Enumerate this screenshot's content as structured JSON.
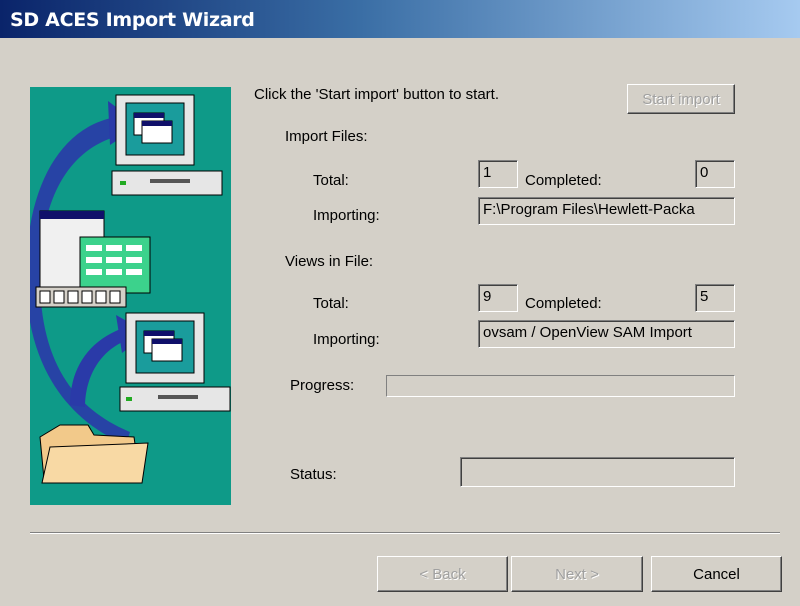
{
  "window": {
    "title": "SD ACES Import Wizard"
  },
  "intro": {
    "text": "Click the 'Start import' button to start."
  },
  "buttons": {
    "start_import": "Start import",
    "back": "< Back",
    "next": "Next >",
    "cancel": "Cancel"
  },
  "import_files": {
    "heading": "Import Files:",
    "total_label": "Total:",
    "total_value": "1",
    "completed_label": "Completed:",
    "completed_value": "0",
    "importing_label": "Importing:",
    "importing_value": "F:\\Program Files\\Hewlett-Packa"
  },
  "views_in_file": {
    "heading": "Views in File:",
    "total_label": "Total:",
    "total_value": "9",
    "completed_label": "Completed:",
    "completed_value": "5",
    "importing_label": "Importing:",
    "importing_value": "ovsam / OpenView SAM Import"
  },
  "progress": {
    "label": "Progress:",
    "value": 0
  },
  "status": {
    "label": "Status:",
    "value": ""
  }
}
